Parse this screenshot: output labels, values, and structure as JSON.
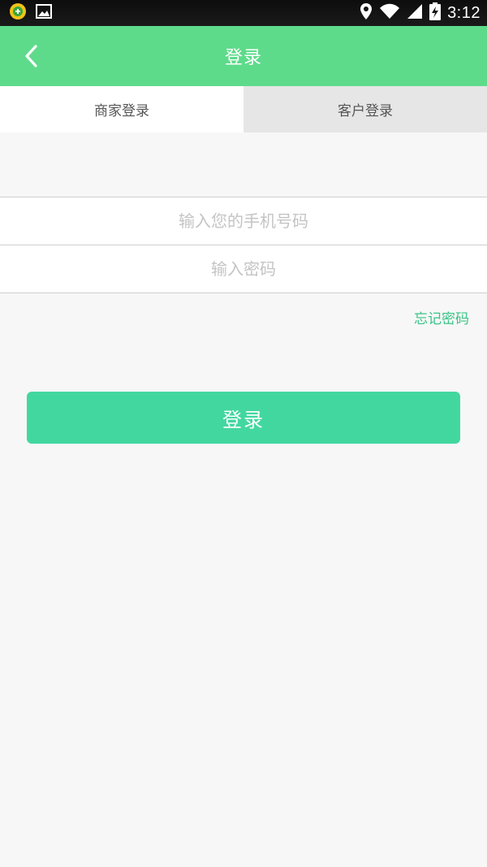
{
  "status_bar": {
    "time": "3:12",
    "left_icons": [
      "app-notification-icon",
      "image-notification-icon"
    ],
    "right_icons": [
      "location-pin-icon",
      "wifi-icon",
      "cellular-signal-icon",
      "battery-charging-icon"
    ]
  },
  "header": {
    "title": "登录",
    "back_icon": "chevron-left-icon"
  },
  "tabs": [
    {
      "label": "商家登录",
      "active": true
    },
    {
      "label": "客户登录",
      "active": false
    }
  ],
  "form": {
    "phone_placeholder": "输入您的手机号码",
    "phone_value": "",
    "password_placeholder": "输入密码",
    "password_value": "",
    "forgot_label": "忘记密码",
    "submit_label": "登录"
  },
  "colors": {
    "header_bg": "#5ddb8a",
    "button_bg": "#43d7a0",
    "link": "#39c486",
    "page_bg": "#f7f7f7"
  }
}
